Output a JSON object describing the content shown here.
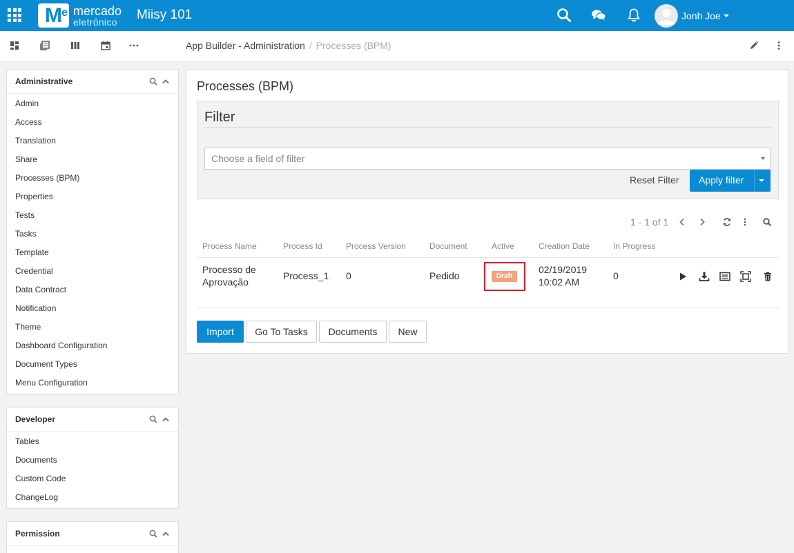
{
  "header": {
    "logo_line1": "mercado",
    "logo_line2": "eletrônico",
    "logo_mark": "M",
    "logo_mark_sup": "e",
    "app_name": "Miisy 101",
    "user_name": "Jonh Joe",
    "icons": [
      "apps-grid-icon",
      "search-icon",
      "chat-icon",
      "bell-icon",
      "avatar"
    ],
    "bg_color": "#0a8bd3"
  },
  "toolbar": {
    "icons": [
      "dashboard-icon",
      "pages-icon",
      "columns-icon",
      "calendar-icon",
      "more-horizontal-icon",
      "edit-icon",
      "more-vertical-icon"
    ]
  },
  "breadcrumb": {
    "items": [
      "App Builder - Administration",
      "Processes (BPM)"
    ],
    "separator": "/"
  },
  "sidebar": {
    "panels": [
      {
        "title": "Administrative",
        "items": [
          "Admin",
          "Access",
          "Translation",
          "Share",
          "Processes (BPM)",
          "Properties",
          "Tests",
          "Tasks",
          "Template",
          "Credential",
          "Data Contract",
          "Notification",
          "Theme",
          "Dashboard Configuration",
          "Document Types",
          "Menu Configuration"
        ]
      },
      {
        "title": "Developer",
        "items": [
          "Tables",
          "Documents",
          "Custom Code",
          "ChangeLog"
        ]
      },
      {
        "title": "Permission",
        "items": []
      }
    ]
  },
  "main": {
    "title": "Processes (BPM)",
    "filter": {
      "title": "Filter",
      "placeholder": "Choose a field of filter",
      "reset_label": "Reset Filter",
      "apply_label": "Apply filter"
    },
    "pager": {
      "text": "1 - 1 of 1"
    },
    "table": {
      "columns": [
        "Process Name",
        "Process Id",
        "Process Version",
        "Document",
        "Active",
        "Creation Date",
        "In Progress"
      ],
      "rows": [
        {
          "process_name_line1": "Processo de",
          "process_name_line2": "Aprovação",
          "process_id": "Process_1",
          "process_version": "0",
          "document": "Pedido",
          "active": "Draft",
          "creation_date_line1": "02/19/2019",
          "creation_date_line2": "10:02 AM",
          "in_progress": "0",
          "actions": [
            "play-icon",
            "download-icon",
            "list-icon",
            "fullscreen-icon",
            "trash-icon"
          ]
        }
      ]
    },
    "buttons": {
      "import": "Import",
      "go_to_tasks": "Go To Tasks",
      "documents": "Documents",
      "new": "New"
    }
  }
}
